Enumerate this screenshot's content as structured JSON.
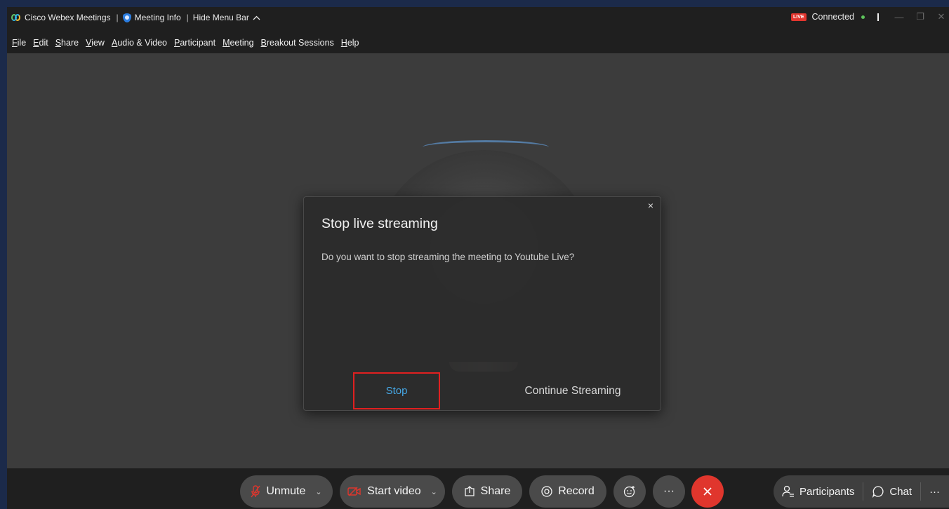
{
  "titlebar": {
    "app_name": "Cisco Webex Meetings",
    "meeting_info": "Meeting Info",
    "hide_menu_bar": "Hide Menu Bar",
    "live_badge": "LIVE",
    "connection_status": "Connected"
  },
  "menu": {
    "items": [
      {
        "key": "F",
        "rest": "ile"
      },
      {
        "key": "E",
        "rest": "dit"
      },
      {
        "key": "S",
        "rest": "hare"
      },
      {
        "key": "V",
        "rest": "iew"
      },
      {
        "key": "A",
        "rest": "udio & Video"
      },
      {
        "key": "P",
        "rest": "articipant"
      },
      {
        "key": "M",
        "rest": "eeting"
      },
      {
        "key": "B",
        "rest": "reakout Sessions"
      },
      {
        "key": "H",
        "rest": "elp"
      }
    ]
  },
  "dialog": {
    "title": "Stop live streaming",
    "message": "Do you want to stop streaming the meeting to Youtube Live?",
    "stop_label": "Stop",
    "continue_label": "Continue Streaming",
    "close_symbol": "×"
  },
  "toolbar": {
    "unmute_label": "Unmute",
    "start_video_label": "Start video",
    "share_label": "Share",
    "record_label": "Record",
    "more_symbol": "···",
    "participants_label": "Participants",
    "chat_label": "Chat"
  },
  "colors": {
    "accent_blue": "#46a8e6",
    "highlight_red": "#e02020",
    "end_call_red": "#e0362d",
    "live_red": "#e2352e",
    "connected_green": "#5ec45c"
  }
}
